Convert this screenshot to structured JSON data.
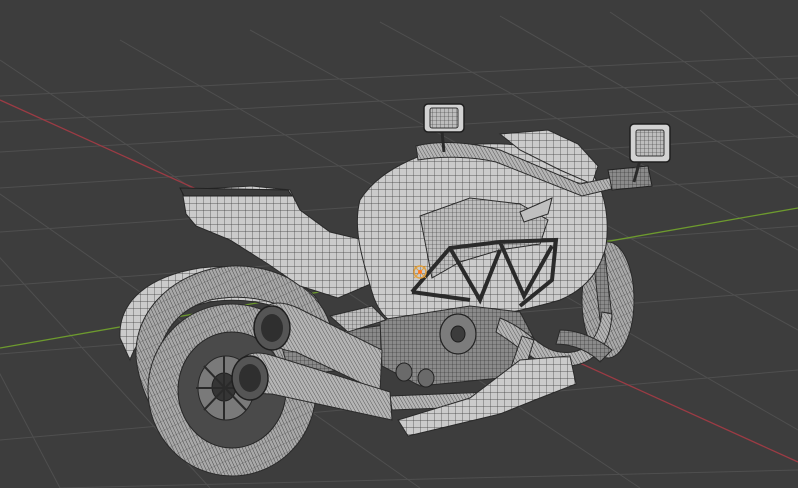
{
  "viewport": {
    "mode": "3D Viewport",
    "shading": "solid-wireframe",
    "background_color": "#3d3d3d",
    "grid_color": "#4f4f4f",
    "x_axis_color": "#9b3b44",
    "y_axis_color": "#6d9a2e",
    "origin_marker_color": "#e0a040"
  },
  "scene": {
    "object": "motorcycle-mesh",
    "mesh_fill_color": "#c9c9c9",
    "wire_color": "#3a3a3a",
    "dark_part_color": "#5a5a5a"
  }
}
